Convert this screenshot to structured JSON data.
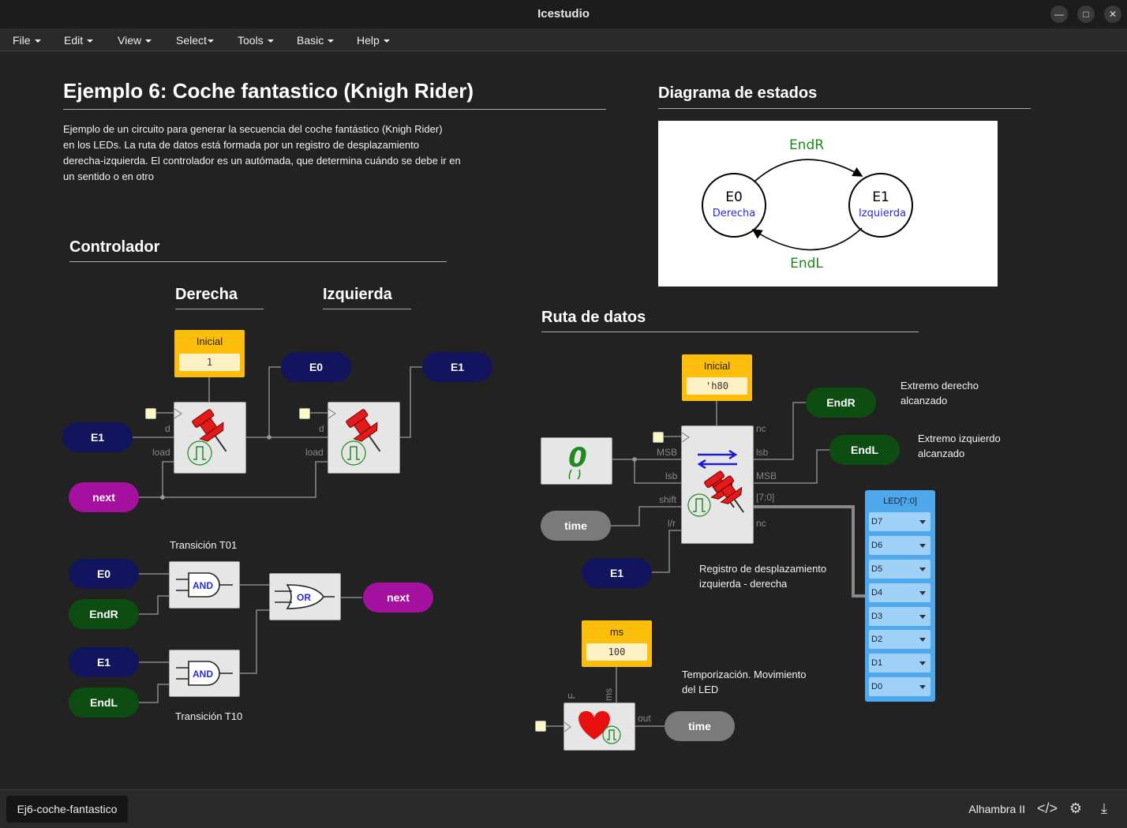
{
  "window": {
    "title": "Icestudio"
  },
  "menu": [
    {
      "label": "File"
    },
    {
      "label": "Edit"
    },
    {
      "label": "View"
    },
    {
      "label": "Select"
    },
    {
      "label": "Tools"
    },
    {
      "label": "Basic"
    },
    {
      "label": "Help"
    }
  ],
  "canvas": {
    "title": "Ejemplo 6: Coche fantastico (Knigh Rider)",
    "description": [
      "Ejemplo de un circuito para generar la secuencia del coche fantástico (Knigh Rider)",
      "en los LEDs. La ruta de datos está formada por un registro de desplazamiento",
      "derecha-izquierda. El controlador es un autómada, que determina cuándo se debe ir en",
      "un sentido o en otro"
    ],
    "fsm_heading": "Diagrama de estados",
    "fsm": {
      "e0_name": "E0",
      "e0_sub": "Derecha",
      "e1_name": "E1",
      "e1_sub": "Izquierda",
      "top_label": "EndR",
      "bottom_label": "EndL"
    },
    "controller_heading": "Controlador",
    "derecha_heading": "Derecha",
    "izquierda_heading": "Izquierda",
    "datapath_heading": "Ruta de datos",
    "ctrl": {
      "inicial_label": "Inicial",
      "inicial_value": "1",
      "e0_out": "E0",
      "e1_out": "E1",
      "e1_in": "E1",
      "next_in": "next",
      "port_d": "d",
      "port_load": "load"
    },
    "trans": {
      "t01_label": "Transición T01",
      "t10_label": "Transición T10",
      "e0": "E0",
      "endr": "EndR",
      "e1": "E1",
      "endl": "EndL",
      "and_label": "AND",
      "or_label": "OR",
      "next_out": "next"
    },
    "datapath": {
      "inicial_label": "Inicial",
      "inicial_value": "'h80",
      "zero": "0",
      "time_in": "time",
      "e1_in": "E1",
      "ports_left": [
        "MSB",
        "lsb",
        "shift",
        "l/r"
      ],
      "ports_right": [
        "nc",
        "lsb",
        "MSB",
        "[7:0]",
        "nc"
      ],
      "endr_out": "EndR",
      "endl_out": "EndL",
      "note_endr": [
        "Extremo derecho",
        "alcanzado"
      ],
      "note_endl": [
        "Extremo izquierdo",
        "alcanzado"
      ],
      "note_reg": [
        "Registro de desplazamiento",
        "izquierda - derecha"
      ],
      "led_title": "LED[7:0]",
      "leds": [
        "D7",
        "D6",
        "D5",
        "D4",
        "D3",
        "D2",
        "D1",
        "D0"
      ]
    },
    "timer": {
      "ms_label": "ms",
      "ms_value": "100",
      "port_f": "F",
      "port_ms": "ms",
      "port_out": "out",
      "time_out": "time",
      "note": [
        "Temporización. Movimiento",
        "del LED"
      ]
    }
  },
  "statusbar": {
    "tab": "Ej6-coche-fantastico",
    "board": "Alhambra II"
  }
}
